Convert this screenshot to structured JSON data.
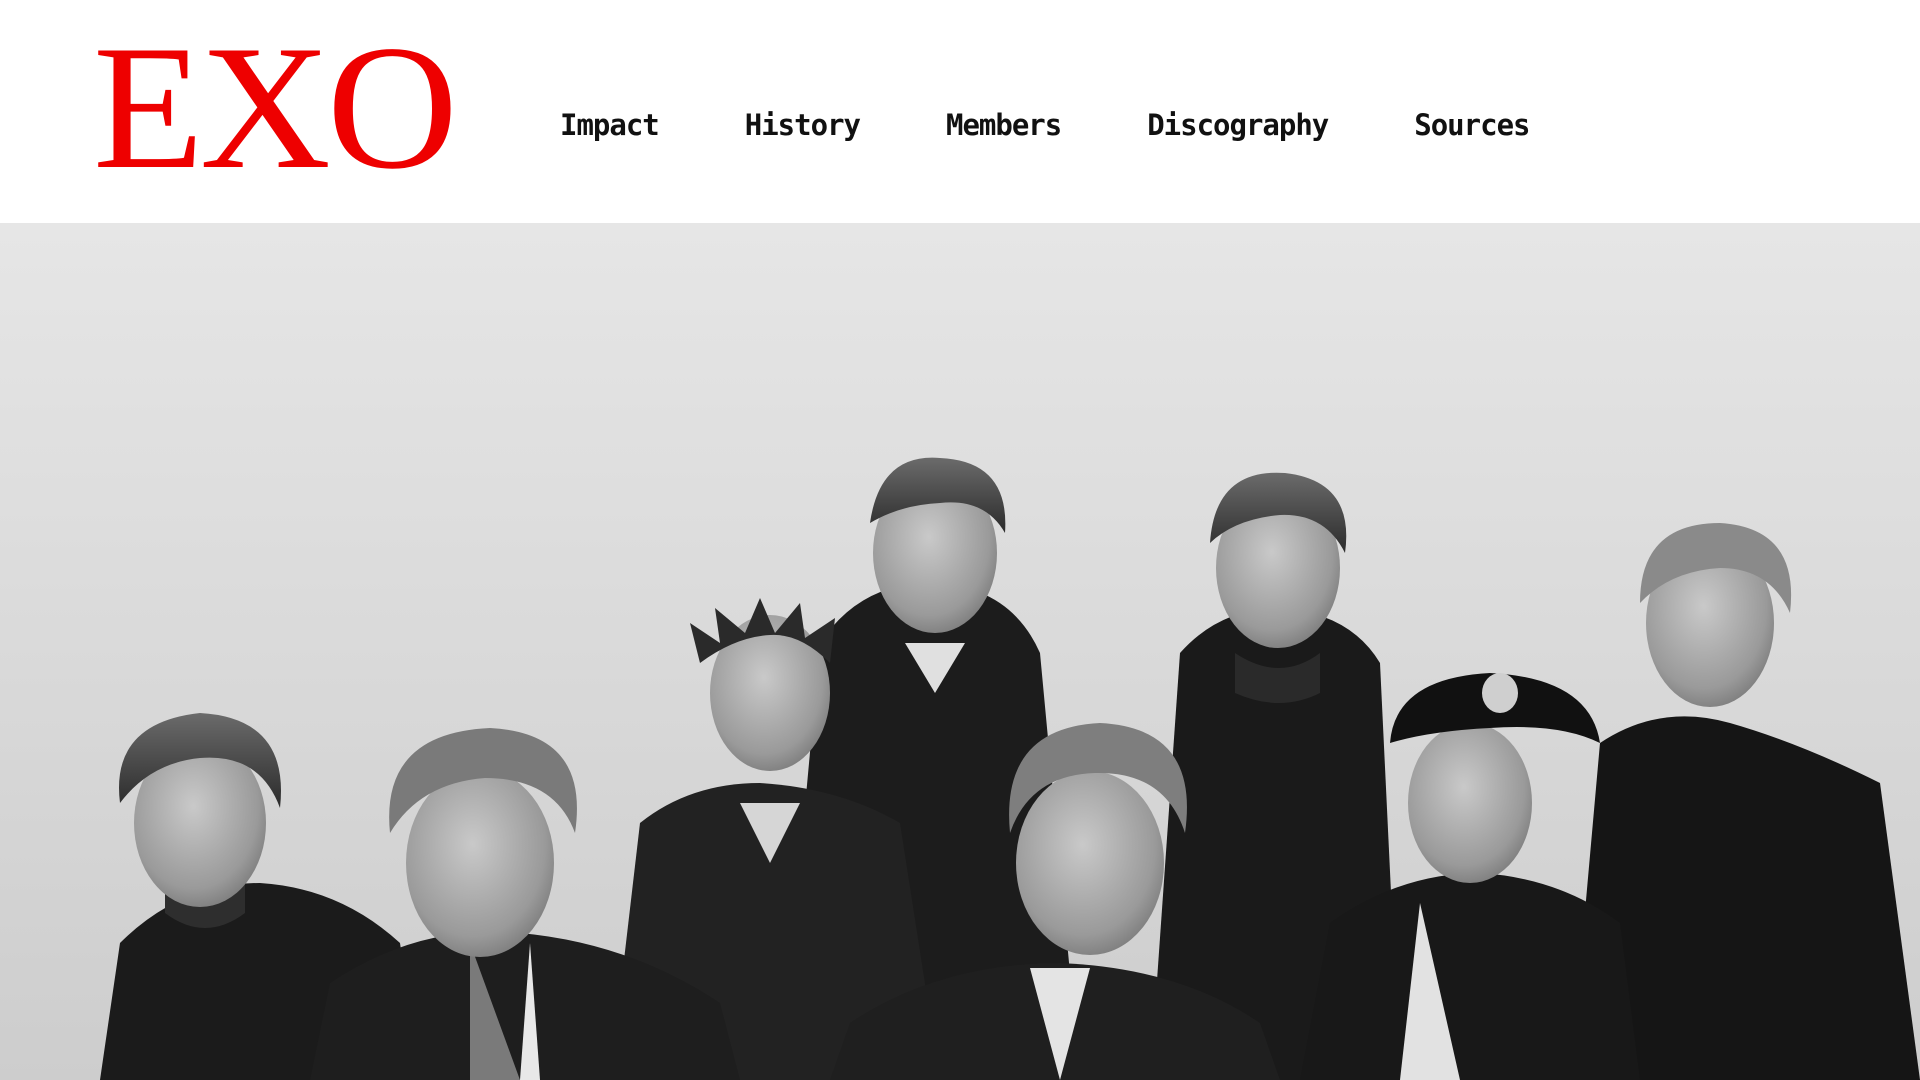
{
  "site": {
    "logo_text": "EXO",
    "brand_color": "#ee0000"
  },
  "nav": {
    "items": [
      {
        "label": "Impact"
      },
      {
        "label": "History"
      },
      {
        "label": "Members"
      },
      {
        "label": "Discography"
      },
      {
        "label": "Sources"
      }
    ]
  },
  "hero": {
    "image_style": "black-and-white group photo",
    "member_count": 8,
    "background_color": "#dedede"
  }
}
